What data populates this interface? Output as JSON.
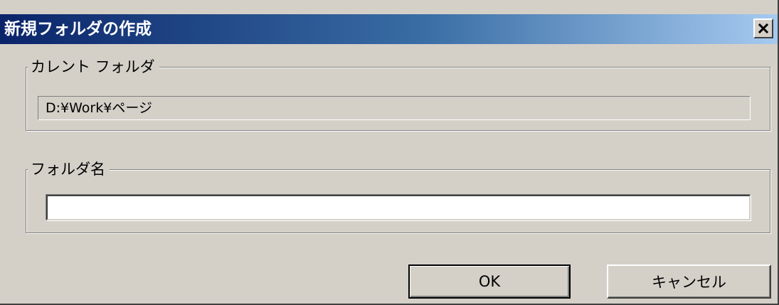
{
  "window": {
    "title": "新規フォルダの作成",
    "close_icon": "close-icon"
  },
  "current_folder_group": {
    "label": "カレント フォルダ",
    "path": "D:¥Work¥ページ"
  },
  "folder_name_group": {
    "label": "フォルダ名",
    "value": "",
    "placeholder": ""
  },
  "buttons": {
    "ok": "OK",
    "cancel": "キャンセル"
  },
  "colors": {
    "title_start": "#0a246a",
    "title_end": "#a6caf0",
    "dialog_face": "#d4d0c8"
  }
}
